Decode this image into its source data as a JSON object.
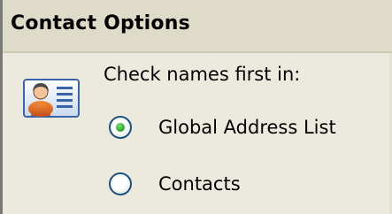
{
  "section": {
    "title": "Contact Options",
    "icon": "contact-card-icon"
  },
  "prompt": "Check names first in:",
  "options": [
    {
      "label": "Global Address List",
      "selected": true
    },
    {
      "label": "Contacts",
      "selected": false
    }
  ],
  "colors": {
    "background": "#eceadf",
    "header_background": "#dedcc9",
    "radio_border": "#1c5180",
    "radio_selected": "#2fa82a"
  }
}
